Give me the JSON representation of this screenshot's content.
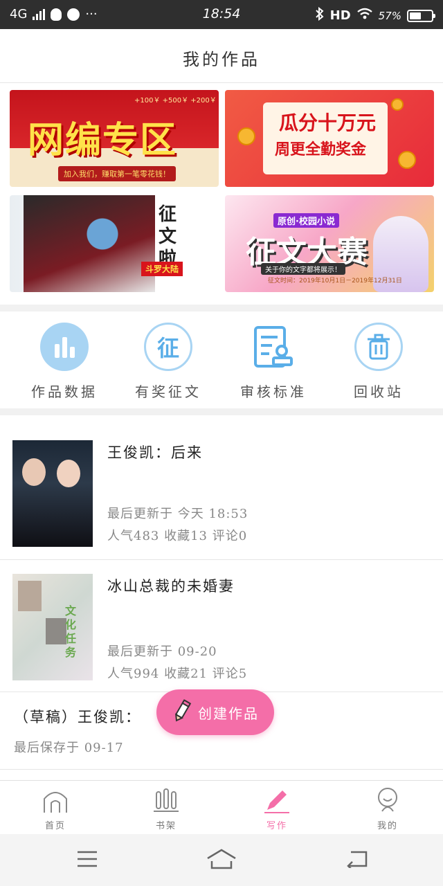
{
  "status_bar": {
    "network": "4G",
    "time": "18:54",
    "hd": "HD",
    "battery_text": "57%",
    "more": "···"
  },
  "header": {
    "title": "我的作品"
  },
  "banners": {
    "b1": {
      "main": "网编专区",
      "strip": "加入我们，赚取第一笔零花钱！",
      "top": "+100￥ +500￥ +200￥"
    },
    "b2": {
      "line1": "瓜分十万元",
      "line2": "周更全勤奖金"
    },
    "b3": {
      "vertical": "征文啦",
      "tag": "斗罗大陆"
    },
    "b4": {
      "label": "原创·校园小说",
      "main": "征文大赛",
      "sub": "关于你的文字都将展示！",
      "date": "征文时间：2019年10月1日－2019年12月31日"
    }
  },
  "quick_actions": [
    {
      "label": "作品数据",
      "icon": "bar-chart-icon"
    },
    {
      "label": "有奖征文",
      "icon": "contest-icon"
    },
    {
      "label": "审核标准",
      "icon": "review-standard-icon"
    },
    {
      "label": "回收站",
      "icon": "trash-icon"
    }
  ],
  "works": [
    {
      "title": "王俊凯：后来",
      "updated": "最后更新于 今天 18:53",
      "stats": "人气483 收藏13 评论0"
    },
    {
      "title": "冰山总裁的未婚妻",
      "updated": "最后更新于 09-20",
      "stats": "人气994 收藏21 评论5"
    }
  ],
  "draft": {
    "title": "（草稿）王俊凯：",
    "saved": "最后保存于 09-17"
  },
  "fab": {
    "label": "创建作品"
  },
  "tabs": [
    {
      "label": "首页",
      "icon": "home-icon"
    },
    {
      "label": "书架",
      "icon": "bookshelf-icon"
    },
    {
      "label": "写作",
      "icon": "pen-icon"
    },
    {
      "label": "我的",
      "icon": "profile-icon"
    }
  ],
  "colors": {
    "accent": "#f46ea8",
    "icon_blue": "#5aaee8",
    "icon_light_blue": "#a8d4f3"
  }
}
